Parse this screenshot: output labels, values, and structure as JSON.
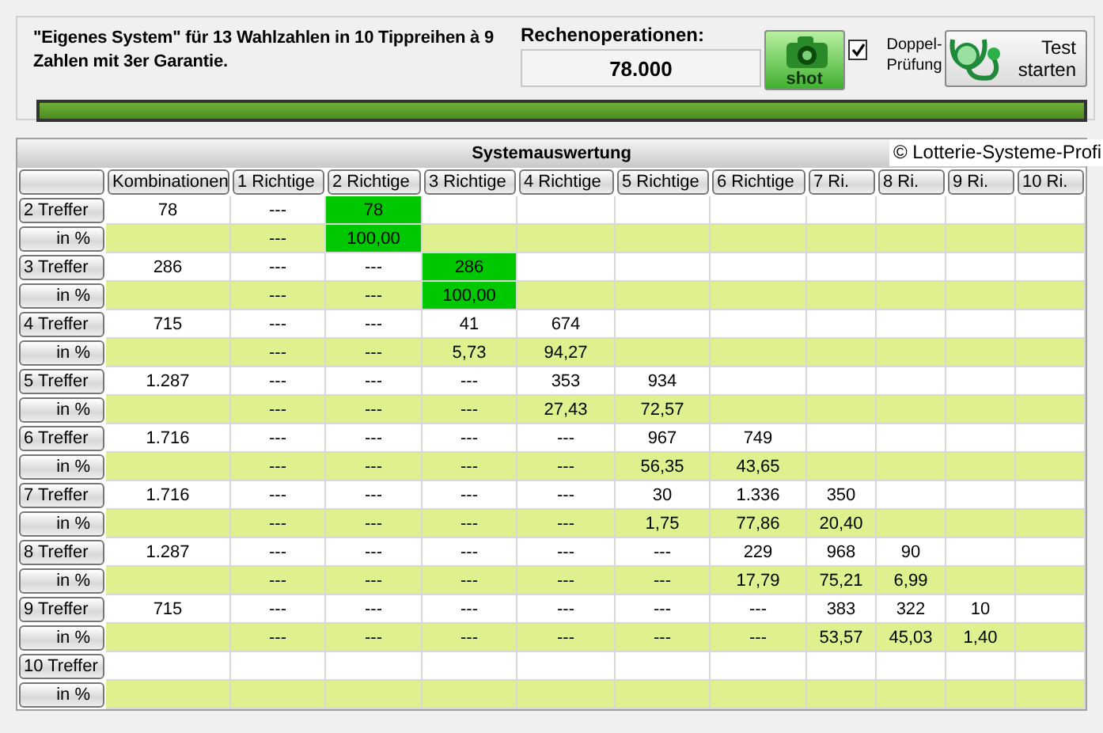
{
  "header": {
    "description": "\"Eigenes System\" für 13 Wahlzahlen in 10 Tippreihen à 9 Zahlen mit 3er Garantie.",
    "operations_label": "Rechenoperationen:",
    "operations_value": "78.000",
    "shot_button": "shot",
    "double_check": {
      "label": "Doppel-Prüfung",
      "checked": true
    },
    "test_button": "Test starten",
    "progress": {
      "level": 1.0
    }
  },
  "table": {
    "title": "Systemauswertung",
    "copyright": "© Lotterie-Systeme-Profi",
    "columns": [
      "Kombinationen",
      "1 Richtige",
      "2 Richtige",
      "3 Richtige",
      "4 Richtige",
      "5 Richtige",
      "6 Richtige",
      "7 Ri.",
      "8 Ri.",
      "9 Ri.",
      "10 Ri."
    ],
    "rows": [
      {
        "label": "2 Treffer",
        "kind": "count",
        "cells": [
          {
            "text": "78",
            "highlighted": false
          },
          {
            "text": "---",
            "highlighted": false
          },
          {
            "text": "78",
            "highlighted": true
          },
          null,
          null,
          null,
          null,
          null,
          null,
          null,
          null
        ]
      },
      {
        "label": "in %",
        "kind": "percent",
        "cells": [
          null,
          {
            "text": "---",
            "highlighted": false
          },
          {
            "text": "100,00",
            "highlighted": true
          },
          null,
          null,
          null,
          null,
          null,
          null,
          null,
          null
        ]
      },
      {
        "label": "3 Treffer",
        "kind": "count",
        "cells": [
          {
            "text": "286",
            "highlighted": false
          },
          {
            "text": "---",
            "highlighted": false
          },
          {
            "text": "---",
            "highlighted": false
          },
          {
            "text": "286",
            "highlighted": true
          },
          null,
          null,
          null,
          null,
          null,
          null,
          null
        ]
      },
      {
        "label": "in %",
        "kind": "percent",
        "cells": [
          null,
          {
            "text": "---",
            "highlighted": false
          },
          {
            "text": "---",
            "highlighted": false
          },
          {
            "text": "100,00",
            "highlighted": true
          },
          null,
          null,
          null,
          null,
          null,
          null,
          null
        ]
      },
      {
        "label": "4 Treffer",
        "kind": "count",
        "cells": [
          {
            "text": "715",
            "highlighted": false
          },
          {
            "text": "---",
            "highlighted": false
          },
          {
            "text": "---",
            "highlighted": false
          },
          {
            "text": "41",
            "highlighted": false
          },
          {
            "text": "674",
            "highlighted": false
          },
          null,
          null,
          null,
          null,
          null,
          null
        ]
      },
      {
        "label": "in %",
        "kind": "percent",
        "cells": [
          null,
          {
            "text": "---",
            "highlighted": false
          },
          {
            "text": "---",
            "highlighted": false
          },
          {
            "text": "5,73",
            "highlighted": false
          },
          {
            "text": "94,27",
            "highlighted": false
          },
          null,
          null,
          null,
          null,
          null,
          null
        ]
      },
      {
        "label": "5 Treffer",
        "kind": "count",
        "cells": [
          {
            "text": "1.287",
            "highlighted": false
          },
          {
            "text": "---",
            "highlighted": false
          },
          {
            "text": "---",
            "highlighted": false
          },
          {
            "text": "---",
            "highlighted": false
          },
          {
            "text": "353",
            "highlighted": false
          },
          {
            "text": "934",
            "highlighted": false
          },
          null,
          null,
          null,
          null,
          null
        ]
      },
      {
        "label": "in %",
        "kind": "percent",
        "cells": [
          null,
          {
            "text": "---",
            "highlighted": false
          },
          {
            "text": "---",
            "highlighted": false
          },
          {
            "text": "---",
            "highlighted": false
          },
          {
            "text": "27,43",
            "highlighted": false
          },
          {
            "text": "72,57",
            "highlighted": false
          },
          null,
          null,
          null,
          null,
          null
        ]
      },
      {
        "label": "6 Treffer",
        "kind": "count",
        "cells": [
          {
            "text": "1.716",
            "highlighted": false
          },
          {
            "text": "---",
            "highlighted": false
          },
          {
            "text": "---",
            "highlighted": false
          },
          {
            "text": "---",
            "highlighted": false
          },
          {
            "text": "---",
            "highlighted": false
          },
          {
            "text": "967",
            "highlighted": false
          },
          {
            "text": "749",
            "highlighted": false
          },
          null,
          null,
          null,
          null
        ]
      },
      {
        "label": "in %",
        "kind": "percent",
        "cells": [
          null,
          {
            "text": "---",
            "highlighted": false
          },
          {
            "text": "---",
            "highlighted": false
          },
          {
            "text": "---",
            "highlighted": false
          },
          {
            "text": "---",
            "highlighted": false
          },
          {
            "text": "56,35",
            "highlighted": false
          },
          {
            "text": "43,65",
            "highlighted": false
          },
          null,
          null,
          null,
          null
        ]
      },
      {
        "label": "7 Treffer",
        "kind": "count",
        "cells": [
          {
            "text": "1.716",
            "highlighted": false
          },
          {
            "text": "---",
            "highlighted": false
          },
          {
            "text": "---",
            "highlighted": false
          },
          {
            "text": "---",
            "highlighted": false
          },
          {
            "text": "---",
            "highlighted": false
          },
          {
            "text": "30",
            "highlighted": false
          },
          {
            "text": "1.336",
            "highlighted": false
          },
          {
            "text": "350",
            "highlighted": false
          },
          null,
          null,
          null
        ]
      },
      {
        "label": "in %",
        "kind": "percent",
        "cells": [
          null,
          {
            "text": "---",
            "highlighted": false
          },
          {
            "text": "---",
            "highlighted": false
          },
          {
            "text": "---",
            "highlighted": false
          },
          {
            "text": "---",
            "highlighted": false
          },
          {
            "text": "1,75",
            "highlighted": false
          },
          {
            "text": "77,86",
            "highlighted": false
          },
          {
            "text": "20,40",
            "highlighted": false
          },
          null,
          null,
          null
        ]
      },
      {
        "label": "8 Treffer",
        "kind": "count",
        "cells": [
          {
            "text": "1.287",
            "highlighted": false
          },
          {
            "text": "---",
            "highlighted": false
          },
          {
            "text": "---",
            "highlighted": false
          },
          {
            "text": "---",
            "highlighted": false
          },
          {
            "text": "---",
            "highlighted": false
          },
          {
            "text": "---",
            "highlighted": false
          },
          {
            "text": "229",
            "highlighted": false
          },
          {
            "text": "968",
            "highlighted": false
          },
          {
            "text": "90",
            "highlighted": false
          },
          null,
          null
        ]
      },
      {
        "label": "in %",
        "kind": "percent",
        "cells": [
          null,
          {
            "text": "---",
            "highlighted": false
          },
          {
            "text": "---",
            "highlighted": false
          },
          {
            "text": "---",
            "highlighted": false
          },
          {
            "text": "---",
            "highlighted": false
          },
          {
            "text": "---",
            "highlighted": false
          },
          {
            "text": "17,79",
            "highlighted": false
          },
          {
            "text": "75,21",
            "highlighted": false
          },
          {
            "text": "6,99",
            "highlighted": false
          },
          null,
          null
        ]
      },
      {
        "label": "9 Treffer",
        "kind": "count",
        "cells": [
          {
            "text": "715",
            "highlighted": false
          },
          {
            "text": "---",
            "highlighted": false
          },
          {
            "text": "---",
            "highlighted": false
          },
          {
            "text": "---",
            "highlighted": false
          },
          {
            "text": "---",
            "highlighted": false
          },
          {
            "text": "---",
            "highlighted": false
          },
          {
            "text": "---",
            "highlighted": false
          },
          {
            "text": "383",
            "highlighted": false
          },
          {
            "text": "322",
            "highlighted": false
          },
          {
            "text": "10",
            "highlighted": false
          },
          null
        ]
      },
      {
        "label": "in %",
        "kind": "percent",
        "cells": [
          null,
          {
            "text": "---",
            "highlighted": false
          },
          {
            "text": "---",
            "highlighted": false
          },
          {
            "text": "---",
            "highlighted": false
          },
          {
            "text": "---",
            "highlighted": false
          },
          {
            "text": "---",
            "highlighted": false
          },
          {
            "text": "---",
            "highlighted": false
          },
          {
            "text": "53,57",
            "highlighted": false
          },
          {
            "text": "45,03",
            "highlighted": false
          },
          {
            "text": "1,40",
            "highlighted": false
          },
          null
        ]
      },
      {
        "label": "10 Treffer",
        "kind": "count",
        "cells": [
          null,
          null,
          null,
          null,
          null,
          null,
          null,
          null,
          null,
          null,
          null
        ]
      },
      {
        "label": "in %",
        "kind": "percent",
        "cells": [
          null,
          null,
          null,
          null,
          null,
          null,
          null,
          null,
          null,
          null,
          null
        ]
      }
    ]
  }
}
